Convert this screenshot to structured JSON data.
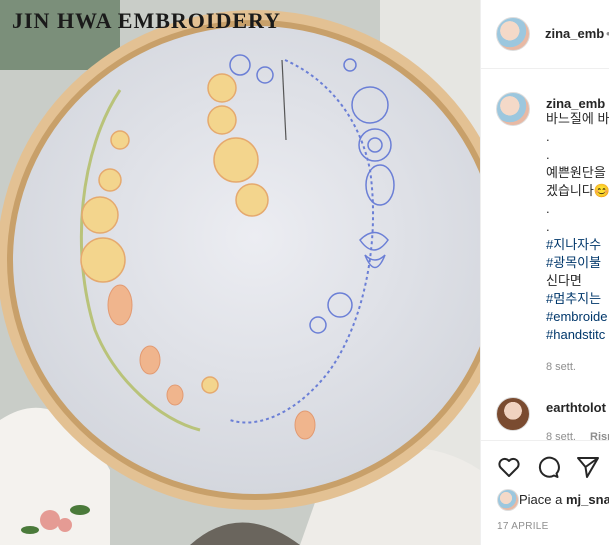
{
  "post": {
    "watermark": "JIN HWA EMBROIDERY",
    "author": "zina_emb",
    "header_suffix": "•",
    "caption_lines": [
      {
        "text": "바느질에 바",
        "tag": false
      },
      {
        "text": ".",
        "tag": false
      },
      {
        "text": ".",
        "tag": false
      },
      {
        "text": "예쁜원단을",
        "tag": false
      },
      {
        "text": "겠습니다😊",
        "tag": false
      },
      {
        "text": ".",
        "tag": false
      },
      {
        "text": ".",
        "tag": false
      },
      {
        "text": "#지나자수",
        "tag": true
      },
      {
        "text": "#광목이불",
        "tag": true
      },
      {
        "text": "신다면",
        "tag": false
      },
      {
        "text": "#멈추지는",
        "tag": true
      },
      {
        "text": "#embroide",
        "tag": true
      },
      {
        "text": "#handstitc",
        "tag": true
      }
    ],
    "caption_time": "8 sett.",
    "comment": {
      "user": "earthtolot",
      "time": "8 sett.",
      "reply": "Rispo"
    },
    "likes_prefix": "Piace a",
    "likes_user": "mj_sna",
    "date": "17 APRILE"
  },
  "icons": {
    "like": "heart-icon",
    "comment": "comment-icon",
    "share": "send-icon"
  },
  "colors": {
    "link": "#00376b",
    "text": "#262626",
    "meta": "#8e8e8e",
    "hoop": "#d9b27c",
    "blue_stitch": "#6b7fd6",
    "yellow_stitch": "#f1d58a"
  }
}
